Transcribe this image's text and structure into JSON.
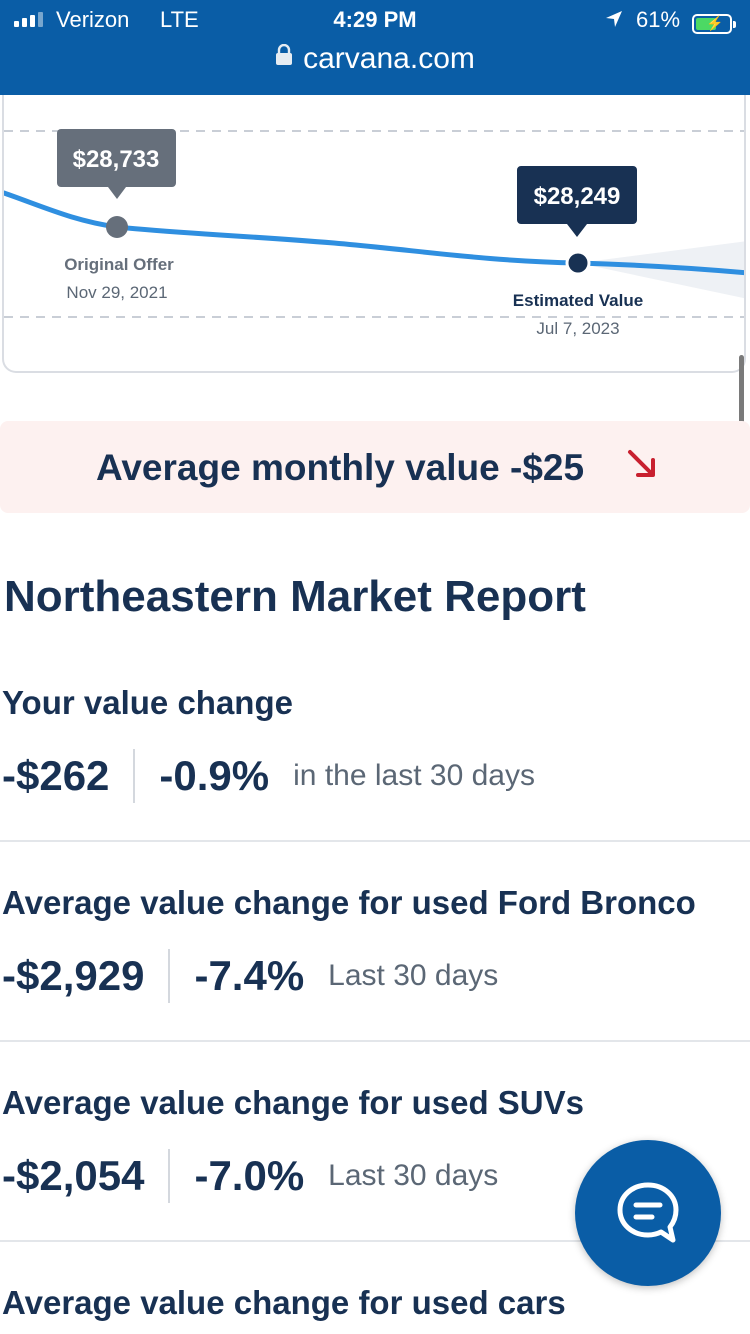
{
  "status_bar": {
    "carrier": "Verizon",
    "network": "LTE",
    "time": "4:29 PM",
    "battery_percent": "61%",
    "battery_level": 0.61
  },
  "browser": {
    "url": "carvana.com"
  },
  "value_chart": {
    "original_offer": {
      "price": "$28,733",
      "label": "Original Offer",
      "date": "Nov 29, 2021"
    },
    "estimated_value": {
      "price": "$28,249",
      "label": "Estimated Value",
      "date": "Jul 7, 2023"
    }
  },
  "banner": {
    "text": "Average monthly value -$25",
    "trend": "down"
  },
  "report": {
    "title": "Northeastern Market Report",
    "sections": [
      {
        "title": "Your value change",
        "amount": "-$262",
        "percent": "-0.9%",
        "period": "in the last 30 days"
      },
      {
        "title": "Average value change for used Ford Bronco",
        "amount": "-$2,929",
        "percent": "-7.4%",
        "period": "Last 30 days"
      },
      {
        "title": "Average value change for used SUVs",
        "amount": "-$2,054",
        "percent": "-7.0%",
        "period": "Last 30 days"
      },
      {
        "title": "Average value change for used cars"
      }
    ]
  },
  "colors": {
    "brand_blue": "#0a5da6",
    "navy": "#183153",
    "line_blue": "#2f8fe0",
    "banner_bg": "#fdf1f0",
    "trend_red": "#c8202f"
  }
}
